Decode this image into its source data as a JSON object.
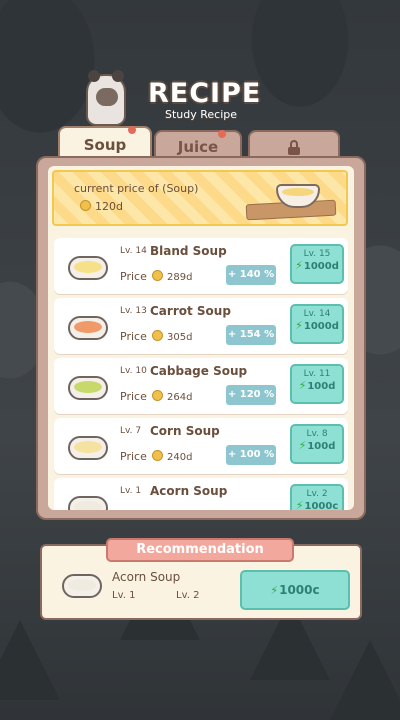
{
  "header": {
    "title": "RECIPE",
    "subtitle": "Study Recipe"
  },
  "tabs": [
    {
      "label": "Soup",
      "active": true,
      "notification": true
    },
    {
      "label": "Juice",
      "active": false,
      "notification": true
    },
    {
      "label": "",
      "active": false,
      "icon": "lock-icon"
    }
  ],
  "banner": {
    "label": "current price of (Soup)",
    "value": "120d"
  },
  "recipes": [
    {
      "level": "Lv. 14",
      "name": "Bland Soup",
      "price_label": "Price",
      "price": "289d",
      "bonus": "+ 140 %",
      "next_level": "Lv. 15",
      "cost": "1000d",
      "color": "#f6e08a"
    },
    {
      "level": "Lv. 13",
      "name": "Carrot Soup",
      "price_label": "Price",
      "price": "305d",
      "bonus": "+ 154 %",
      "next_level": "Lv. 14",
      "cost": "1000d",
      "color": "#f09a6a"
    },
    {
      "level": "Lv. 10",
      "name": "Cabbage Soup",
      "price_label": "Price",
      "price": "264d",
      "bonus": "+ 120 %",
      "next_level": "Lv. 11",
      "cost": "100d",
      "color": "#c9d86a"
    },
    {
      "level": "Lv. 7",
      "name": "Corn Soup",
      "price_label": "Price",
      "price": "240d",
      "bonus": "+ 100 %",
      "next_level": "Lv. 8",
      "cost": "100d",
      "color": "#f6e2a0"
    },
    {
      "level": "Lv. 1",
      "name": "Acorn Soup",
      "price_label": "Price",
      "price": "",
      "bonus": "",
      "next_level": "Lv. 2",
      "cost": "1000c",
      "color": "#f0ebe0"
    }
  ],
  "recommendation": {
    "title": "Recommendation",
    "name": "Acorn Soup",
    "current_level": "Lv. 1",
    "next_level": "Lv. 2",
    "cost": "1000c"
  },
  "colors": {
    "accent_teal": "#8fe0d4",
    "tab_active": "#fbf3e2",
    "banner_yellow": "#fde7a8"
  }
}
